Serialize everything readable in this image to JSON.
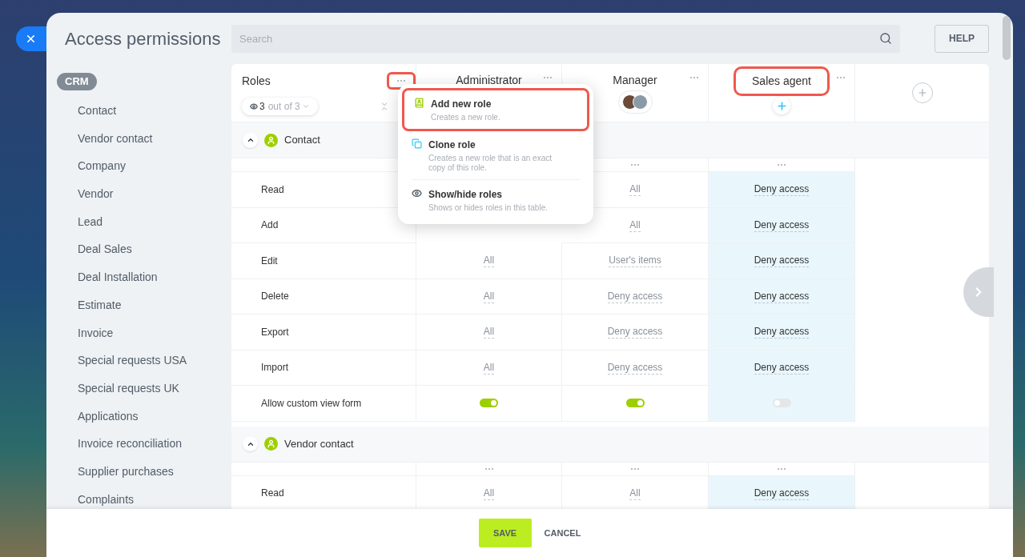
{
  "title": "Access permissions",
  "search": {
    "placeholder": "Search"
  },
  "help_button": "HELP",
  "sidebar": {
    "group": "CRM",
    "items": [
      "Contact",
      "Vendor contact",
      "Company",
      "Vendor",
      "Lead",
      "Deal Sales",
      "Deal Installation",
      "Estimate",
      "Invoice",
      "Special requests USA",
      "Special requests UK",
      "Applications",
      "Invoice reconciliation",
      "Supplier purchases",
      "Complaints"
    ]
  },
  "roles_header": {
    "label": "Roles",
    "menu_highlighted": true,
    "filter": {
      "count": "3",
      "total": "out of 3"
    }
  },
  "roles": [
    {
      "name": "Administrator",
      "selected": false,
      "highlighted": false
    },
    {
      "name": "Manager",
      "selected": false,
      "highlighted": false,
      "kind": "avatars"
    },
    {
      "name": "Sales agent",
      "selected": true,
      "highlighted": true,
      "kind": "add"
    }
  ],
  "menu": [
    {
      "kind": "add",
      "title": "Add new role",
      "description": "Creates a new role.",
      "highlighted": true,
      "divider_above": false
    },
    {
      "kind": "clone",
      "title": "Clone role",
      "description": "Creates a new role that is an exact copy of this role.",
      "highlighted": false,
      "divider_above": false
    },
    {
      "kind": "visibility",
      "title": "Show/hide roles",
      "description": "Shows or hides roles in this table.",
      "highlighted": false,
      "divider_above": true
    }
  ],
  "sections": [
    {
      "title": "Contact",
      "expanded": true,
      "rows": [
        {
          "label": "Read",
          "cells": [
            null,
            {
              "kind": "text",
              "value": "All"
            },
            {
              "kind": "text",
              "value": "Deny access"
            }
          ]
        },
        {
          "label": "Add",
          "cells": [
            null,
            {
              "kind": "text",
              "value": "All"
            },
            {
              "kind": "text",
              "value": "Deny access"
            }
          ]
        },
        {
          "label": "Edit",
          "cells": [
            {
              "kind": "text",
              "value": "All"
            },
            {
              "kind": "text",
              "value": "User's items"
            },
            {
              "kind": "text",
              "value": "Deny access"
            }
          ]
        },
        {
          "label": "Delete",
          "cells": [
            {
              "kind": "text",
              "value": "All"
            },
            {
              "kind": "text",
              "value": "Deny access"
            },
            {
              "kind": "text",
              "value": "Deny access"
            }
          ]
        },
        {
          "label": "Export",
          "cells": [
            {
              "kind": "text",
              "value": "All"
            },
            {
              "kind": "text",
              "value": "Deny access"
            },
            {
              "kind": "text",
              "value": "Deny access"
            }
          ]
        },
        {
          "label": "Import",
          "cells": [
            {
              "kind": "text",
              "value": "All"
            },
            {
              "kind": "text",
              "value": "Deny access"
            },
            {
              "kind": "text",
              "value": "Deny access"
            }
          ]
        },
        {
          "label": "Allow custom view form",
          "cells": [
            {
              "kind": "toggle",
              "on": true
            },
            {
              "kind": "toggle",
              "on": true
            },
            {
              "kind": "toggle",
              "on": false
            }
          ]
        }
      ]
    },
    {
      "title": "Vendor contact",
      "expanded": true,
      "rows": [
        {
          "label": "Read",
          "cells": [
            {
              "kind": "text",
              "value": "All"
            },
            {
              "kind": "text",
              "value": "All"
            },
            {
              "kind": "text",
              "value": "Deny access"
            }
          ]
        }
      ]
    }
  ],
  "footer": {
    "save": "SAVE",
    "cancel": "CANCEL"
  }
}
